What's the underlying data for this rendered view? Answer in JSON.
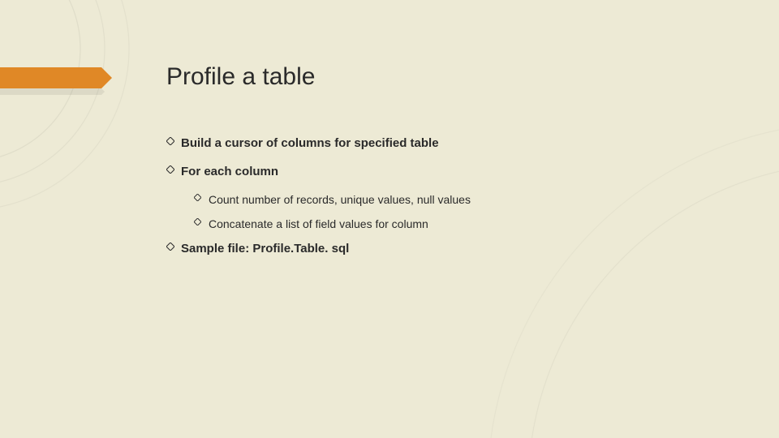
{
  "title": "Profile a table",
  "bullets": {
    "b1": "Build a cursor of columns for specified table",
    "b2": "For each column",
    "b2a": "Count number of records, unique values, null values",
    "b2b": "Concatenate a list of field values for column",
    "b3": "Sample file: Profile.Table. sql"
  }
}
